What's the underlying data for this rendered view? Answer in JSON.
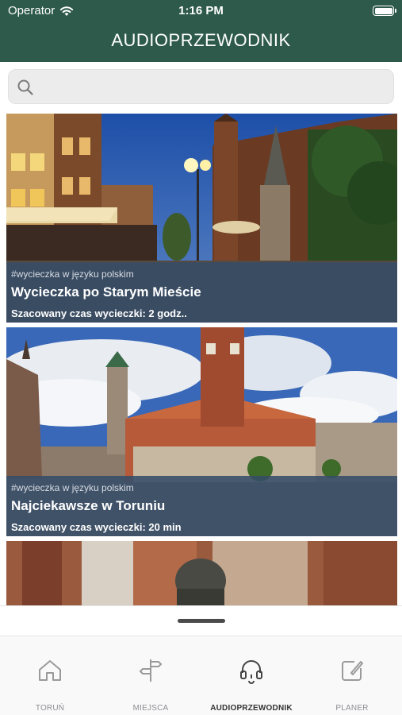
{
  "status": {
    "carrier": "Operator",
    "time": "1:16 PM"
  },
  "header": {
    "title": "AUDIOPRZEWODNIK"
  },
  "search": {
    "placeholder": "",
    "value": ""
  },
  "tours": [
    {
      "tag": "#wycieczka w języku polskim",
      "title": "Wycieczka po Starym Mieście",
      "duration": "Szacowany czas wycieczki: 2 godz.."
    },
    {
      "tag": "#wycieczka w języku polskim",
      "title": "Najciekawsze w Toruniu",
      "duration": "Szacowany czas wycieczki: 20 min"
    }
  ],
  "tabs": [
    {
      "label": "TORUŃ",
      "icon": "house-icon",
      "active": false
    },
    {
      "label": "MIEJSCA",
      "icon": "signpost-icon",
      "active": false
    },
    {
      "label": "AUDIOPRZEWODNIK",
      "icon": "headphones-icon",
      "active": true
    },
    {
      "label": "PLANER",
      "icon": "edit-icon",
      "active": false
    }
  ],
  "colors": {
    "header_bg": "#2e5a4b",
    "card_overlay": "#364c68",
    "active_tab": "#333333",
    "inactive_tab": "#8e8e93"
  }
}
